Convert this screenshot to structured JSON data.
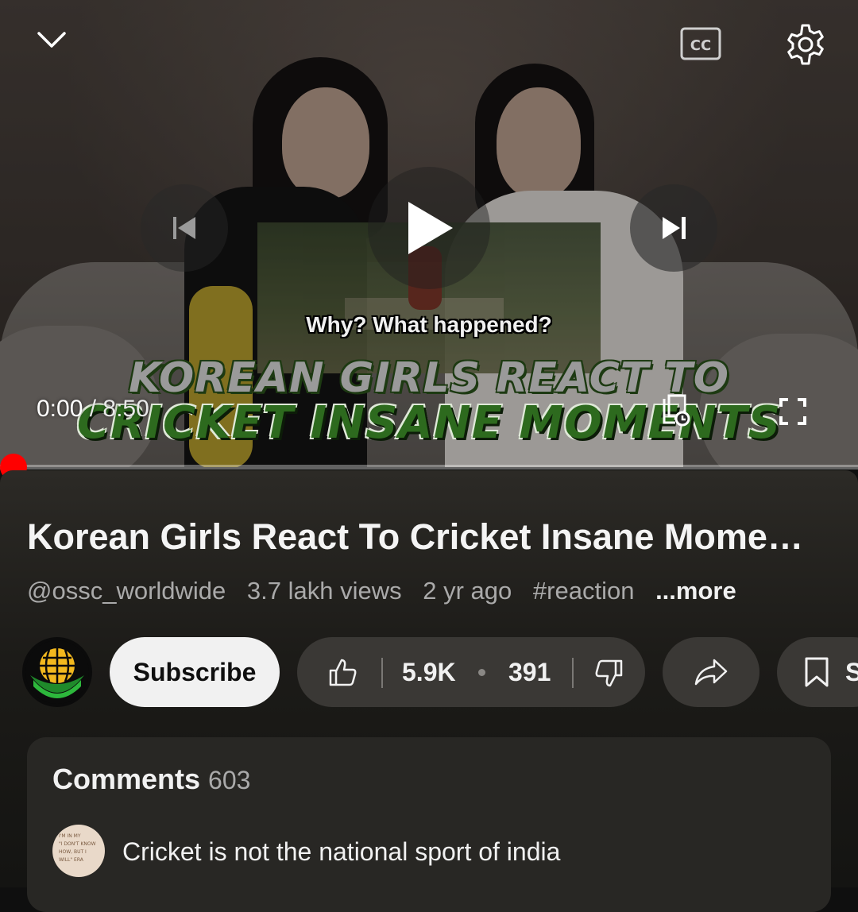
{
  "player": {
    "subtitle": "Why? What happened?",
    "thumb_title_line1": "KOREAN GIRLS REACT TO",
    "thumb_title_line2": "CRICKET INSANE MOMENTS",
    "current_time": "0:00",
    "duration": "8:50",
    "progress_fraction": 0.0,
    "accent_color": "#ff0000",
    "icons": [
      "chevron-down-icon",
      "closed-captions-icon",
      "gear-icon",
      "previous-icon",
      "play-icon",
      "next-icon",
      "queue-icon",
      "fullscreen-icon"
    ]
  },
  "video": {
    "title": "Korean Girls React To Cricket Insane Mome…",
    "channel_handle": "@ossc_worldwide",
    "views": "3.7 lakh views",
    "age": "2 yr ago",
    "hashtag": "#reaction",
    "more_label": "...more"
  },
  "actions": {
    "subscribe_label": "Subscribe",
    "like_count": "5.9K",
    "dislike_count": "391",
    "save_label": "S"
  },
  "comments": {
    "heading": "Comments",
    "count": "603",
    "top_comment": "Cricket is not the national sport of india",
    "avatar_text": [
      "I'M IN MY",
      "\"I DON'T KNOW",
      "HOW, BUT I",
      "WILL\" ERA"
    ]
  }
}
